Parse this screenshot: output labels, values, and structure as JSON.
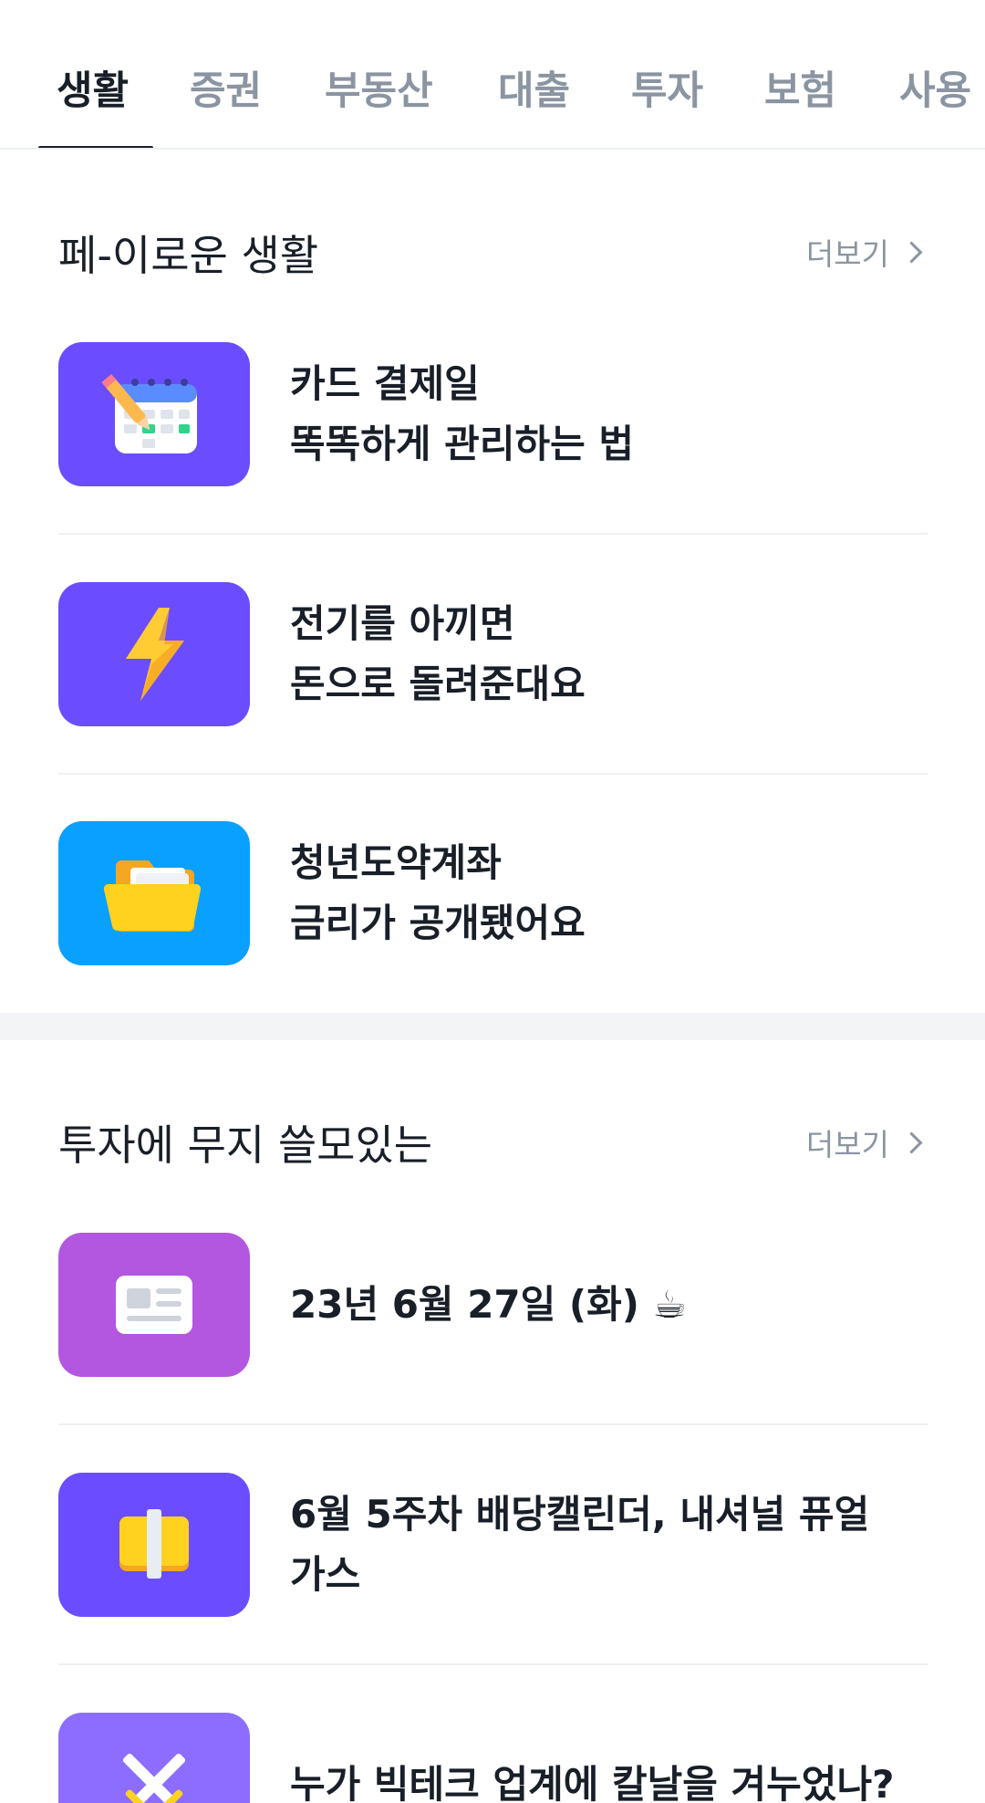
{
  "tabs": [
    {
      "label": "생활"
    },
    {
      "label": "증권"
    },
    {
      "label": "부동산"
    },
    {
      "label": "대출"
    },
    {
      "label": "투자"
    },
    {
      "label": "보험"
    },
    {
      "label": "사용"
    }
  ],
  "section1": {
    "title": "페-이로운 생활",
    "more": "더보기",
    "items": [
      {
        "text": "카드 결제일\n똑똑하게 관리하는 법",
        "icon": "calendar-icon",
        "color": "#6b4dff"
      },
      {
        "text": "전기를 아끼면\n돈으로 돌려준대요",
        "icon": "lightning-icon",
        "color": "#6b4dff"
      },
      {
        "text": "청년도약계좌\n금리가 공개됐어요",
        "icon": "folder-icon",
        "color": "#0aa0ff"
      }
    ]
  },
  "section2": {
    "title": "투자에 무지 쓸모있는",
    "more": "더보기",
    "items": [
      {
        "text": "23년 6월 27일 (화) ☕",
        "icon": "newspaper-icon",
        "color": "#b356e0"
      },
      {
        "text": "6월 5주차 배당캘린더, 내셔널 퓨얼\n가스",
        "icon": "money-stack-icon",
        "color": "#6b4dff"
      },
      {
        "text": "누가 빅테크 업계에 칼날을 겨누었나?",
        "icon": "crossed-swords-icon",
        "color": "#8c6dff"
      }
    ]
  }
}
